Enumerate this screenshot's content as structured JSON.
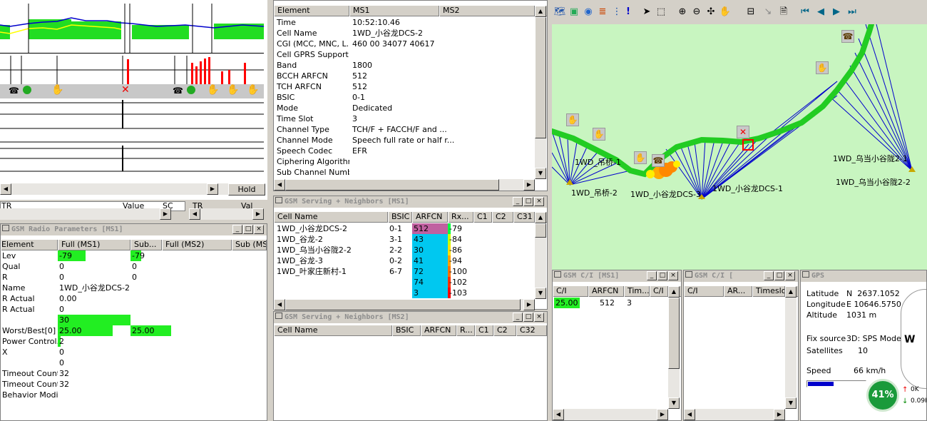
{
  "left_top": {
    "hscroll_button": "Hold",
    "columns": [
      "TR",
      "Value",
      "SC",
      "TR",
      "Val"
    ]
  },
  "radio_params": {
    "title": "GSM Radio Parameters [MS1]",
    "headers": [
      "Element",
      "Full (MS1)",
      "Sub...",
      "Full (MS2)",
      "Sub (MS2"
    ],
    "rows": [
      {
        "el": "Lev",
        "full": "-79",
        "sub": "-79",
        "full_bar": 0.38,
        "sub_bar": 0.16
      },
      {
        "el": "Qual",
        "full": "0",
        "sub": "0"
      },
      {
        "el": "R",
        "full": "0",
        "sub": "0"
      },
      {
        "el": "Name",
        "full": "1WD_小谷龙DCS-2",
        "sub": ""
      },
      {
        "el": "R Actual",
        "full": "0.00",
        "sub": ""
      },
      {
        "el": "R Actual",
        "full": "0",
        "sub": ""
      },
      {
        "el": "",
        "full": "30",
        "sub": "",
        "full_bar": 1.0
      },
      {
        "el": "Worst/Best[0]",
        "full": "25.00",
        "sub": "25.00",
        "full_bar": 0.75,
        "sub_bar": 0.6
      },
      {
        "el": "Power Control...",
        "full": "2",
        "sub": "",
        "full_bar": 0.04
      },
      {
        "el": "X",
        "full": "0",
        "sub": ""
      },
      {
        "el": "",
        "full": "0",
        "sub": ""
      },
      {
        "el": "Timeout Count...",
        "full": "32",
        "sub": ""
      },
      {
        "el": "Timeout Count...",
        "full": "32",
        "sub": ""
      },
      {
        "el": "Behavior Modi...",
        "full": "",
        "sub": ""
      }
    ]
  },
  "info_table": {
    "headers": [
      "Element",
      "MS1",
      "MS2"
    ],
    "rows": [
      [
        "Time",
        "10:52:10.46"
      ],
      [
        "Cell Name",
        "1WD_小谷龙DCS-2"
      ],
      [
        "CGI (MCC, MNC, L...",
        "460 00 34077 40617"
      ],
      [
        "Cell GPRS Support",
        ""
      ],
      [
        "Band",
        "1800"
      ],
      [
        "BCCH ARFCN",
        "512"
      ],
      [
        "TCH ARFCN",
        "512"
      ],
      [
        "BSIC",
        "0-1"
      ],
      [
        "Mode",
        "Dedicated"
      ],
      [
        "Time Slot",
        "3"
      ],
      [
        "Channel Type",
        "TCH/F + FACCH/F and ..."
      ],
      [
        "Channel Mode",
        "Speech full rate or half r..."
      ],
      [
        "Speech Codec",
        "EFR"
      ],
      [
        "Ciphering Algorithm",
        ""
      ],
      [
        "Sub Channel Number",
        ""
      ]
    ]
  },
  "neighbors_ms1": {
    "title": "GSM Serving + Neighbors [MS1]",
    "headers": [
      "Cell Name",
      "BSIC",
      "ARFCN",
      "Rx...",
      "C1",
      "C2",
      "C31"
    ],
    "rows": [
      {
        "name": "1WD_小谷龙DCS-2",
        "bsic": "0-1",
        "arfcn": "512",
        "rx": "-79",
        "arfcn_color": "#c060a0",
        "rx_color": "#00ff40"
      },
      {
        "name": "1WD_谷龙-2",
        "bsic": "3-1",
        "arfcn": "43",
        "rx": "-84",
        "arfcn_color": "#00c8f0",
        "rx_color": "#c8ff00"
      },
      {
        "name": "1WD_乌当小谷陇2-2",
        "bsic": "2-2",
        "arfcn": "30",
        "rx": "-86",
        "arfcn_color": "#00c8f0",
        "rx_color": "#ffe000"
      },
      {
        "name": "1WD_谷龙-3",
        "bsic": "0-2",
        "arfcn": "41",
        "rx": "-94",
        "arfcn_color": "#00c8f0",
        "rx_color": "#ffa000"
      },
      {
        "name": "1WD_叶家庄新村-1",
        "bsic": "6-7",
        "arfcn": "72",
        "rx": "-100",
        "arfcn_color": "#00c8f0",
        "rx_color": "#ff7000"
      },
      {
        "name": "",
        "bsic": "",
        "arfcn": "74",
        "rx": "-102",
        "arfcn_color": "#00c8f0",
        "rx_color": "#ff3000"
      },
      {
        "name": "",
        "bsic": "",
        "arfcn": "3",
        "rx": "-103",
        "arfcn_color": "#00c8f0",
        "rx_color": "#ff0000"
      }
    ]
  },
  "neighbors_ms2": {
    "title": "GSM Serving + Neighbors [MS2]",
    "headers": [
      "Cell Name",
      "BSIC",
      "ARFCN",
      "R...",
      "C1",
      "C2",
      "C32"
    ]
  },
  "map": {
    "labels": [
      "1WD_吊桥-1",
      "1WD_吊桥-2",
      "1WD_小谷龙DCS-3",
      "1WD_小谷龙DCS-1",
      "1WD_乌当小谷陇2-1",
      "1WD_乌当小谷陇2-2"
    ]
  },
  "ci_ms1": {
    "title": "GSM C/I [MS1]",
    "headers": [
      "C/I",
      "ARFCN",
      "Tim...",
      "C/I"
    ],
    "row": {
      "ci": "25.00",
      "arfcn": "512",
      "time": "3"
    }
  },
  "ci_ms2": {
    "title": "GSM C/I [",
    "headers": [
      "C/I",
      "AR...",
      "Timeslot"
    ]
  },
  "gps": {
    "title": "GPS",
    "latitude_label": "Latitude",
    "latitude": "N  2637.1052",
    "longitude_label": "Longitude",
    "longitude": "E 10646.5750",
    "altitude_label": "Altitude",
    "altitude": "1031 m",
    "fix_label": "Fix source",
    "fix": "3D: SPS Mode",
    "sat_label": "Satellites",
    "sat": "10",
    "speed_label": "Speed",
    "speed": "66 km/h",
    "compass_w": "W",
    "battery": "41%",
    "up": "0K",
    "down": "0.09K"
  }
}
